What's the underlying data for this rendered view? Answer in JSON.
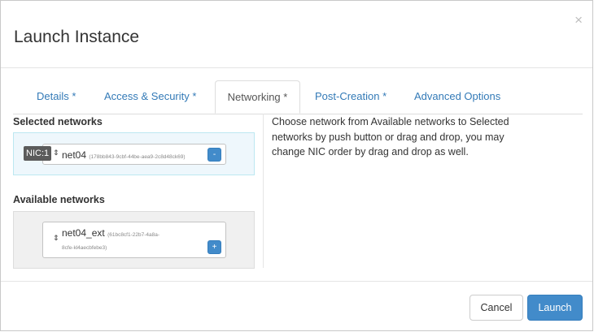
{
  "dialog": {
    "title": "Launch Instance",
    "close_symbol": "×"
  },
  "tabs": [
    {
      "label": "Details *"
    },
    {
      "label": "Access & Security *"
    },
    {
      "label": "Networking *",
      "active": true
    },
    {
      "label": "Post-Creation *"
    },
    {
      "label": "Advanced Options"
    }
  ],
  "selected_networks": {
    "heading": "Selected networks",
    "items": [
      {
        "nic": "NIC:1",
        "name": "net04",
        "id": "(178bb843-9cbf-44be-aea9-2c8d48ck69)",
        "action": "-"
      }
    ]
  },
  "available_networks": {
    "heading": "Available networks",
    "items": [
      {
        "name": "net04_ext",
        "id_line1": "(61bc8cf1-22b7-4a8a-",
        "id_line2": "8cfe-kl4aecbfebe3)",
        "action": "+"
      }
    ]
  },
  "help_text": "Choose network from Available networks to Selected networks by push button or drag and drop, you may change NIC order by drag and drop as well.",
  "footer": {
    "cancel_label": "Cancel",
    "launch_label": "Launch"
  },
  "colors": {
    "accent": "#428bca",
    "link": "#337ab7",
    "selected_bg": "#eef7fc",
    "available_bg": "#f0f0f0"
  },
  "icons": {
    "close": "close-icon",
    "sort": "sort-arrows-icon"
  }
}
